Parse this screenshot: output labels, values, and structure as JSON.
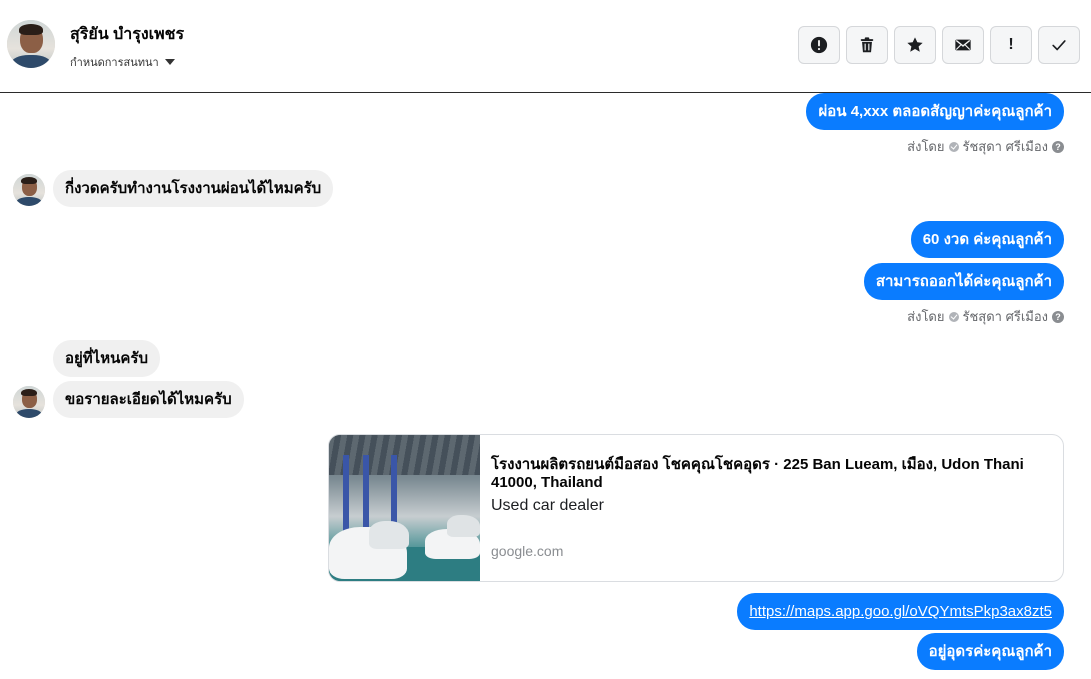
{
  "header": {
    "contact_name": "สุริยัน บำรุงเพชร",
    "assign_label": "กำหนดการสนทนา",
    "tools": [
      {
        "name": "report",
        "icon": "alert-circle-icon"
      },
      {
        "name": "delete",
        "icon": "trash-icon"
      },
      {
        "name": "star",
        "icon": "star-icon"
      },
      {
        "name": "mark-unread",
        "icon": "envelope-icon"
      },
      {
        "name": "important",
        "icon": "exclamation-icon",
        "label": "!"
      },
      {
        "name": "done",
        "icon": "check-icon"
      }
    ]
  },
  "colors": {
    "outgoing_bubble": "#0a7cff",
    "incoming_bubble": "#f0f0f0",
    "sent_by_text": "#65676b"
  },
  "messages": {
    "m1": "ผ่อน 4,xxx ตลอดสัญญาค่ะคุณลูกค้า",
    "m2": "กี่งวดครับทำงานโรงงานผ่อนได้ไหมครับ",
    "m3": "60 งวด ค่ะคุณลูกค้า",
    "m4": "สามารถออกได้ค่ะคุณลูกค้า",
    "m5": "อยู่ที่ไหนครับ",
    "m6": "ขอรายละเอียดได้ไหมครับ",
    "m7": "https://maps.app.goo.gl/oVQYmtsPkp3ax8zt5",
    "m8": "อยู่อุดรค่ะคุณลูกค้า"
  },
  "sent_by": {
    "prefix": "ส่งโดย",
    "agent_name": "รัชสุดา ศรีเมือง",
    "help": "?"
  },
  "link_card": {
    "title": "โรงงานผลิตรถยนต์มือสอง โชคคุณโชคอุดร · 225 Ban Lueam, เมือง, Udon Thani 41000, Thailand",
    "description": "Used car dealer",
    "domain": "google.com"
  }
}
